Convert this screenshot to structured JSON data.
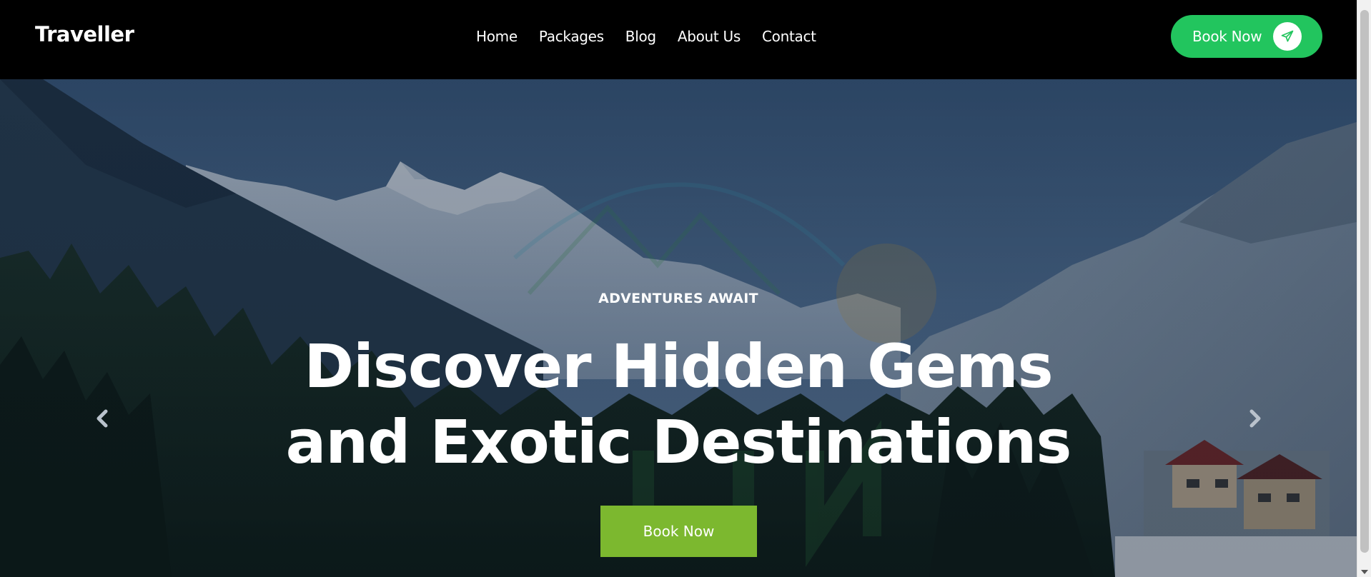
{
  "navbar": {
    "brand": "Traveller",
    "links": [
      "Home",
      "Packages",
      "Blog",
      "About Us",
      "Contact"
    ],
    "cta_label": "Book Now",
    "cta_icon": "paper-plane-icon",
    "cta_color": "#22c55e"
  },
  "hero": {
    "eyebrow": "ADVENTURES AWAIT",
    "title_line1": "Discover Hidden Gems",
    "title_line2": "and Exotic Destinations",
    "cta_label": "Book Now",
    "cta_color": "#7cb82f",
    "prev_icon": "chevron-left-icon",
    "next_icon": "chevron-right-icon"
  }
}
